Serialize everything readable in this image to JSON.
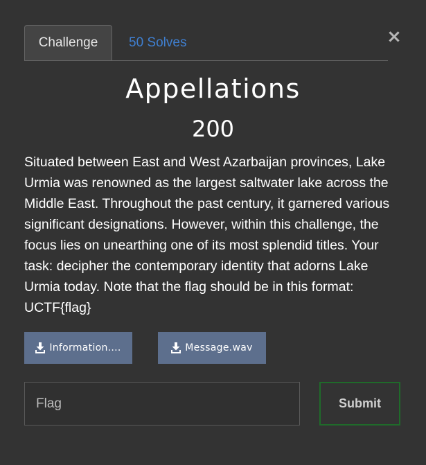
{
  "tabs": {
    "challenge_label": "Challenge",
    "solves_label": "50 Solves"
  },
  "close_glyph": "×",
  "challenge": {
    "title": "Appellations",
    "points": "200",
    "description": "Situated between East and West Azarbaijan provinces, Lake Urmia was renowned as the largest saltwater lake across the Middle East. Throughout the past century, it garnered various significant designations. However, within this challenge, the focus lies on unearthing one of its most splendid titles. Your task: decipher the contemporary identity that adorns Lake Urmia today. Note that the flag should be in this format: UCTF{flag}"
  },
  "files": [
    {
      "label": "Information....",
      "icon": "download-icon"
    },
    {
      "label": "Message.wav",
      "icon": "download-icon"
    }
  ],
  "flag_form": {
    "placeholder": "Flag",
    "value": "",
    "submit_label": "Submit"
  },
  "colors": {
    "background": "#333333",
    "tab_link": "#3f7fd0",
    "file_button": "#5d6f8d",
    "submit_border": "#1f6b2a"
  }
}
